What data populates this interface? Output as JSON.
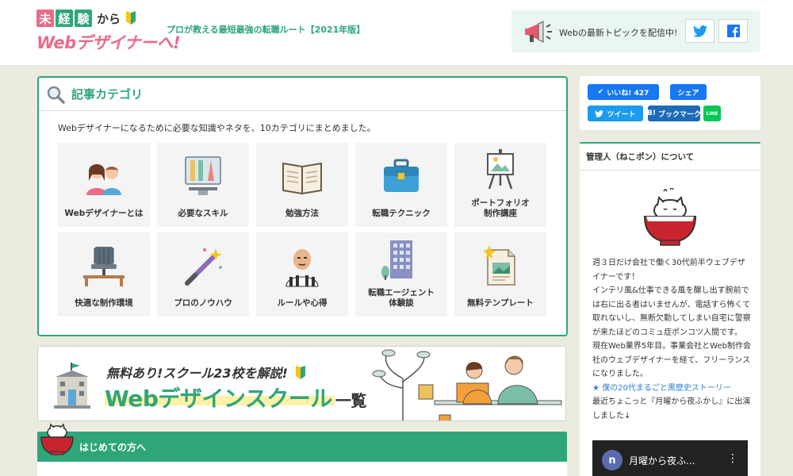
{
  "header": {
    "logo": {
      "chars": [
        "未",
        "経",
        "験"
      ],
      "kara": "から",
      "line2": "Webデザイナーへ!"
    },
    "tagline": "プロが教える最短最強の転職ルート【2021年版】",
    "news_text": "Webの最新トピックを配信中!",
    "sns": [
      "twitter-icon",
      "facebook-icon"
    ]
  },
  "category": {
    "title": "記事カテゴリ",
    "desc": "Webデザイナーになるために必要な知識やネタを、10カテゴリにまとめました。",
    "tiles": [
      {
        "label": "Webデザイナーとは",
        "icon": "people-icon"
      },
      {
        "label": "必要なスキル",
        "icon": "design-tools-icon"
      },
      {
        "label": "勉強方法",
        "icon": "book-icon"
      },
      {
        "label": "転職テクニック",
        "icon": "briefcase-icon"
      },
      {
        "label": "ポートフォリオ\n制作講座",
        "icon": "easel-icon"
      },
      {
        "label": "快適な制作環境",
        "icon": "chair-icon"
      },
      {
        "label": "プロのノウハウ",
        "icon": "magic-wand-icon"
      },
      {
        "label": "ルールや心得",
        "icon": "referee-icon"
      },
      {
        "label": "転職エージェント\n体験談",
        "icon": "building-icon"
      },
      {
        "label": "無料テンプレート",
        "icon": "template-icon"
      }
    ]
  },
  "banner": {
    "sub": "無料あり!スクール23校を解説!",
    "main": "Webデザインスクール",
    "suffix": "一覧"
  },
  "first": {
    "title": "はじめての方へ"
  },
  "share": {
    "like": "いいね! 427",
    "share": "シェア",
    "tweet": "ツイート",
    "hatena": "ブックマーク",
    "line": "LINE"
  },
  "profile": {
    "title": "管理人（ねこポン）について",
    "p1": "週３日だけ会社で働く30代前半ウェブデザイナーです！",
    "p2": "インテリ風&仕事できる風を醸し出す腕前では右に出る者はいませんが、電話すら怖くて取れないし、無断欠勤してしまい自宅に警察が来たほどのコミュ症ポンコツ人間です。",
    "p3": "現在Web業界5年目。事業会社とWeb制作会社のウェブデザイナーを経て、フリーランスになりました。",
    "link": "★ 僕の20代まるごと黒歴史ストーリー",
    "p4": "最近ちょこっと『月曜から夜ふかし』に出演しました↓",
    "video_title": "月曜から夜ふ...",
    "video_avatar": "n"
  },
  "colors": {
    "accent": "#2fa67a",
    "pink": "#e86b8a",
    "twitter": "#1d9bf0",
    "facebook": "#1877f2",
    "line": "#06c755"
  }
}
